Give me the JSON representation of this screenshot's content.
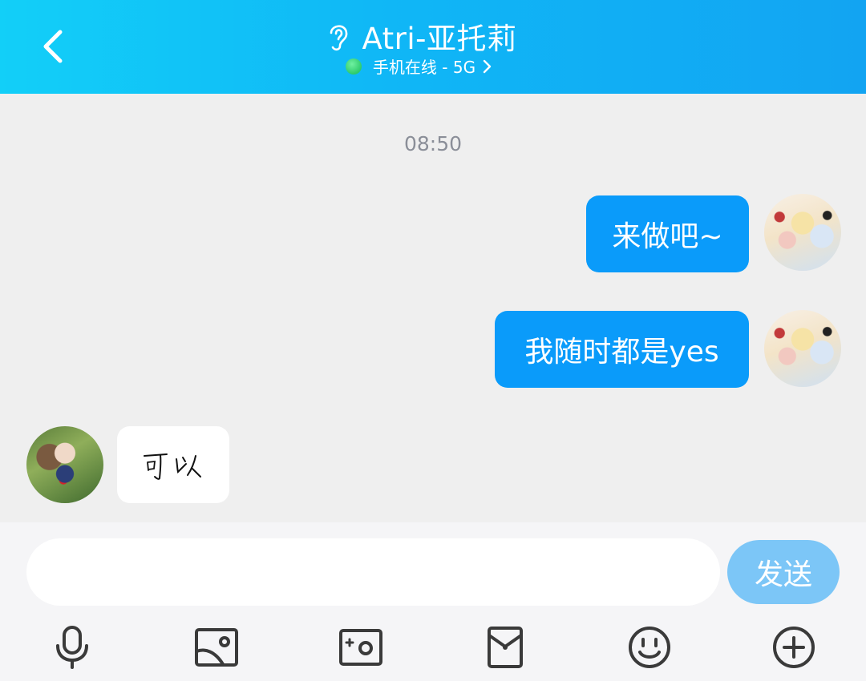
{
  "header": {
    "title": "Atri-亚托莉",
    "status": "手机在线 - 5G",
    "icons": {
      "back": "chevron-left-icon",
      "ear": "ear-icon",
      "status_dot": "online-dot",
      "status_more": "chevron-right-icon"
    },
    "colors": {
      "gradient_start": "#12cff8",
      "gradient_end": "#12a4f2",
      "online": "#2ecb6b"
    }
  },
  "chat": {
    "timestamp": "08:50",
    "messages": [
      {
        "sender": "me",
        "text": "来做吧~"
      },
      {
        "sender": "me",
        "text": "我随时都是yes"
      },
      {
        "sender": "other",
        "type": "handwriting",
        "text": "可以"
      }
    ],
    "colors": {
      "outgoing_bubble": "#0a9bfa",
      "incoming_bubble": "#ffffff"
    }
  },
  "composer": {
    "input_value": "",
    "send_label": "发送",
    "toolbar": [
      {
        "icon": "microphone-icon"
      },
      {
        "icon": "image-icon"
      },
      {
        "icon": "camera-icon"
      },
      {
        "icon": "red-packet-icon"
      },
      {
        "icon": "emoji-icon"
      },
      {
        "icon": "plus-icon"
      }
    ],
    "colors": {
      "send_button": "#7cc6f7"
    }
  }
}
